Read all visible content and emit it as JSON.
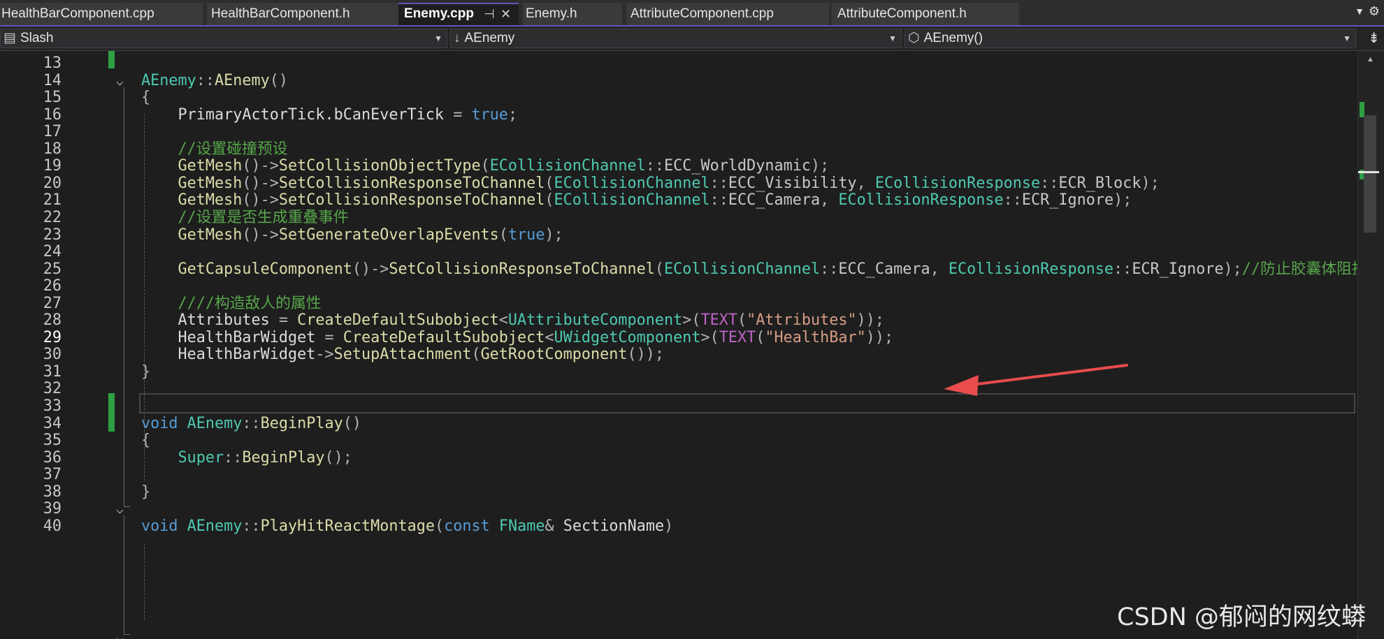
{
  "tabs": [
    {
      "label": "HealthBarComponent.cpp",
      "active": false
    },
    {
      "label": "HealthBarComponent.h",
      "active": false
    },
    {
      "label": "Enemy.cpp",
      "active": true,
      "pin": "⊣",
      "close": "✕"
    },
    {
      "label": "Enemy.h",
      "active": false
    },
    {
      "label": "AttributeComponent.cpp",
      "active": false
    },
    {
      "label": "AttributeComponent.h",
      "active": false
    }
  ],
  "nav": {
    "project": "Slash",
    "scope": "AEnemy",
    "member": "AEnemy()"
  },
  "editor": {
    "current_line": "29",
    "lines": [
      {
        "n": "13",
        "segments": []
      },
      {
        "n": "14",
        "segments": [
          {
            "c": "t",
            "t": "AEnemy"
          },
          {
            "c": "o",
            "t": "::"
          },
          {
            "c": "f",
            "t": "AEnemy"
          },
          {
            "c": "o",
            "t": "()"
          }
        ]
      },
      {
        "n": "15",
        "segments": [
          {
            "c": "o",
            "t": "{"
          }
        ]
      },
      {
        "n": "16",
        "segments": [
          {
            "c": "v",
            "t": "    PrimaryActorTick.bCanEverTick "
          },
          {
            "c": "o",
            "t": "= "
          },
          {
            "c": "k",
            "t": "true"
          },
          {
            "c": "o",
            "t": ";"
          }
        ]
      },
      {
        "n": "17",
        "segments": []
      },
      {
        "n": "18",
        "segments": [
          {
            "c": "c",
            "t": "    //设置碰撞预设"
          }
        ]
      },
      {
        "n": "19",
        "segments": [
          {
            "c": "f",
            "t": "    GetMesh"
          },
          {
            "c": "o",
            "t": "()->"
          },
          {
            "c": "f",
            "t": "SetCollisionObjectType"
          },
          {
            "c": "o",
            "t": "("
          },
          {
            "c": "t",
            "t": "ECollisionChannel"
          },
          {
            "c": "o",
            "t": "::"
          },
          {
            "c": "m",
            "t": "ECC_WorldDynamic"
          },
          {
            "c": "o",
            "t": ");"
          }
        ]
      },
      {
        "n": "20",
        "segments": [
          {
            "c": "f",
            "t": "    GetMesh"
          },
          {
            "c": "o",
            "t": "()->"
          },
          {
            "c": "f",
            "t": "SetCollisionResponseToChannel"
          },
          {
            "c": "o",
            "t": "("
          },
          {
            "c": "t",
            "t": "ECollisionChannel"
          },
          {
            "c": "o",
            "t": "::"
          },
          {
            "c": "m",
            "t": "ECC_Visibility"
          },
          {
            "c": "o",
            "t": ", "
          },
          {
            "c": "t",
            "t": "ECollisionResponse"
          },
          {
            "c": "o",
            "t": "::"
          },
          {
            "c": "m",
            "t": "ECR_Block"
          },
          {
            "c": "o",
            "t": ");"
          }
        ]
      },
      {
        "n": "21",
        "segments": [
          {
            "c": "f",
            "t": "    GetMesh"
          },
          {
            "c": "o",
            "t": "()->"
          },
          {
            "c": "f",
            "t": "SetCollisionResponseToChannel"
          },
          {
            "c": "o",
            "t": "("
          },
          {
            "c": "t",
            "t": "ECollisionChannel"
          },
          {
            "c": "o",
            "t": "::"
          },
          {
            "c": "m",
            "t": "ECC_Camera"
          },
          {
            "c": "o",
            "t": ", "
          },
          {
            "c": "t",
            "t": "ECollisionResponse"
          },
          {
            "c": "o",
            "t": "::"
          },
          {
            "c": "m",
            "t": "ECR_Ignore"
          },
          {
            "c": "o",
            "t": ");"
          }
        ]
      },
      {
        "n": "22",
        "segments": [
          {
            "c": "c",
            "t": "    //设置是否生成重叠事件"
          }
        ]
      },
      {
        "n": "23",
        "segments": [
          {
            "c": "f",
            "t": "    GetMesh"
          },
          {
            "c": "o",
            "t": "()->"
          },
          {
            "c": "f",
            "t": "SetGenerateOverlapEvents"
          },
          {
            "c": "o",
            "t": "("
          },
          {
            "c": "k",
            "t": "true"
          },
          {
            "c": "o",
            "t": ");"
          }
        ]
      },
      {
        "n": "24",
        "segments": []
      },
      {
        "n": "25",
        "segments": [
          {
            "c": "f",
            "t": "    GetCapsuleComponent"
          },
          {
            "c": "o",
            "t": "()->"
          },
          {
            "c": "f",
            "t": "SetCollisionResponseToChannel"
          },
          {
            "c": "o",
            "t": "("
          },
          {
            "c": "t",
            "t": "ECollisionChannel"
          },
          {
            "c": "o",
            "t": "::"
          },
          {
            "c": "m",
            "t": "ECC_Camera"
          },
          {
            "c": "o",
            "t": ", "
          },
          {
            "c": "t",
            "t": "ECollisionResponse"
          },
          {
            "c": "o",
            "t": "::"
          },
          {
            "c": "m",
            "t": "ECR_Ignore"
          },
          {
            "c": "o",
            "t": ");"
          },
          {
            "c": "c",
            "t": "//防止胶囊体阻挡"
          }
        ]
      },
      {
        "n": "26",
        "segments": []
      },
      {
        "n": "27",
        "segments": [
          {
            "c": "c",
            "t": "    ////构造敌人的属性"
          }
        ]
      },
      {
        "n": "28",
        "segments": [
          {
            "c": "v",
            "t": "    Attributes "
          },
          {
            "c": "o",
            "t": "= "
          },
          {
            "c": "f",
            "t": "CreateDefaultSubobject"
          },
          {
            "c": "o",
            "t": "<"
          },
          {
            "c": "t",
            "t": "UAttributeComponent"
          },
          {
            "c": "o",
            "t": ">("
          },
          {
            "c": "mac",
            "t": "TEXT"
          },
          {
            "c": "o",
            "t": "("
          },
          {
            "c": "s",
            "t": "\"Attributes\""
          },
          {
            "c": "o",
            "t": "));"
          }
        ]
      },
      {
        "n": "29",
        "segments": [
          {
            "c": "v",
            "t": "    HealthBarWidget "
          },
          {
            "c": "o",
            "t": "= "
          },
          {
            "c": "f",
            "t": "CreateDefaultSubobject"
          },
          {
            "c": "o",
            "t": "<"
          },
          {
            "c": "t",
            "t": "UWidgetComponent"
          },
          {
            "c": "o",
            "t": ">("
          },
          {
            "c": "mac",
            "t": "TEXT"
          },
          {
            "c": "o",
            "t": "("
          },
          {
            "c": "s",
            "t": "\"HealthBar\""
          },
          {
            "c": "o",
            "t": "));"
          }
        ]
      },
      {
        "n": "30",
        "segments": [
          {
            "c": "v",
            "t": "    HealthBarWidget"
          },
          {
            "c": "o",
            "t": "->"
          },
          {
            "c": "f",
            "t": "SetupAttachment"
          },
          {
            "c": "o",
            "t": "("
          },
          {
            "c": "f",
            "t": "GetRootComponent"
          },
          {
            "c": "o",
            "t": "());"
          }
        ]
      },
      {
        "n": "31",
        "segments": [
          {
            "c": "o",
            "t": "}"
          }
        ]
      },
      {
        "n": "32",
        "segments": []
      },
      {
        "n": "33",
        "segments": []
      },
      {
        "n": "34",
        "segments": [
          {
            "c": "k",
            "t": "void "
          },
          {
            "c": "t",
            "t": "AEnemy"
          },
          {
            "c": "o",
            "t": "::"
          },
          {
            "c": "f",
            "t": "BeginPlay"
          },
          {
            "c": "o",
            "t": "()"
          }
        ]
      },
      {
        "n": "35",
        "segments": [
          {
            "c": "o",
            "t": "{"
          }
        ]
      },
      {
        "n": "36",
        "segments": [
          {
            "c": "t",
            "t": "    Super"
          },
          {
            "c": "o",
            "t": "::"
          },
          {
            "c": "f",
            "t": "BeginPlay"
          },
          {
            "c": "o",
            "t": "();"
          }
        ]
      },
      {
        "n": "37",
        "segments": []
      },
      {
        "n": "38",
        "segments": [
          {
            "c": "o",
            "t": "}"
          }
        ]
      },
      {
        "n": "39",
        "segments": []
      },
      {
        "n": "40",
        "segments": [
          {
            "c": "k",
            "t": "void "
          },
          {
            "c": "t",
            "t": "AEnemy"
          },
          {
            "c": "o",
            "t": "::"
          },
          {
            "c": "f",
            "t": "PlayHitReactMontage"
          },
          {
            "c": "o",
            "t": "("
          },
          {
            "c": "k",
            "t": "const "
          },
          {
            "c": "t",
            "t": "FName"
          },
          {
            "c": "o",
            "t": "& "
          },
          {
            "c": "v",
            "t": "SectionName"
          },
          {
            "c": "o",
            "t": ")"
          }
        ]
      }
    ]
  },
  "colors": {
    "accent": "#6b4fbb",
    "change_marker": "#2ea043",
    "arrow": "#e84c4c"
  },
  "watermark": "CSDN @郁闷的网纹蟒"
}
